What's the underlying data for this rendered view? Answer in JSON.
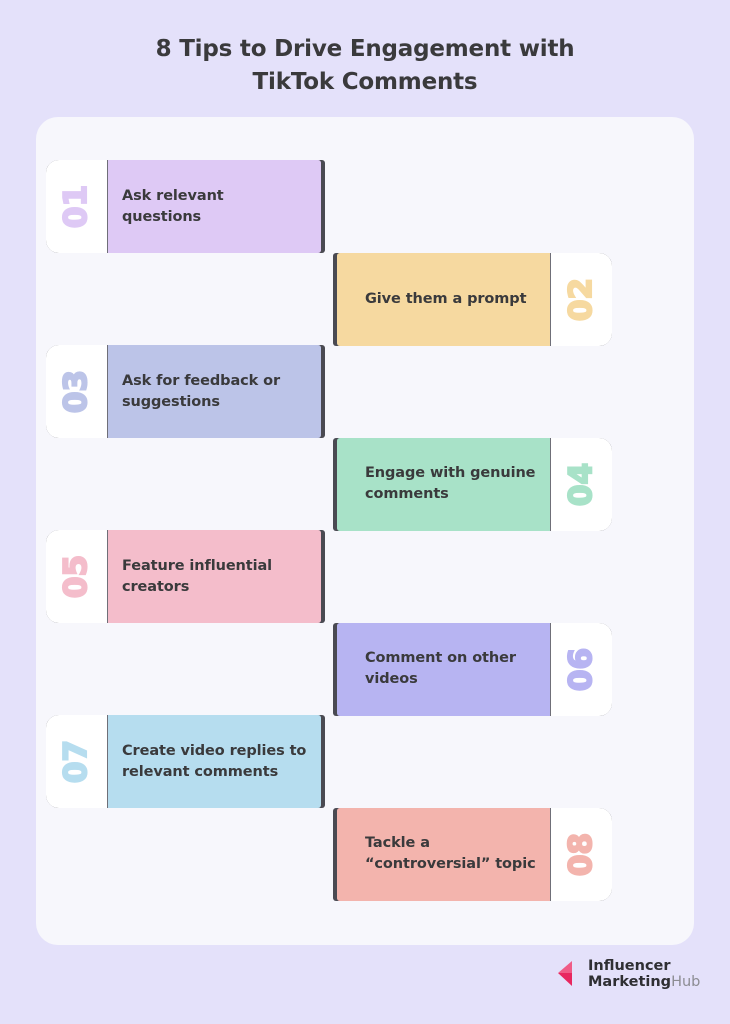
{
  "title": "8 Tips to Drive Engagement with TikTok Comments",
  "title_line1": "8 Tips to Drive Engagement with",
  "title_line2": "TikTok Comments",
  "colors": {
    "page_background": "#e4e1fa",
    "panel_background": "#f7f7fc",
    "text": "#3a3a3c",
    "card_border": "#6f6f78",
    "card_shadow": "#4a4a52"
  },
  "cards": [
    {
      "number": "01",
      "text": "Ask relevant questions",
      "color": "#dec9f5",
      "side": "left"
    },
    {
      "number": "02",
      "text": "Give them a prompt",
      "color": "#f6d9a0",
      "side": "right"
    },
    {
      "number": "03",
      "text": "Ask for feedback or suggestions",
      "color": "#bcc4e8",
      "side": "left"
    },
    {
      "number": "04",
      "text": "Engage with genuine comments",
      "color": "#a8e2c8",
      "side": "right"
    },
    {
      "number": "05",
      "text": "Feature influential creators",
      "color": "#f4bdcb",
      "side": "left"
    },
    {
      "number": "06",
      "text": "Comment on other videos",
      "color": "#b7b4f2",
      "side": "right"
    },
    {
      "number": "07",
      "text": "Create video replies to relevant comments",
      "color": "#b6ddef",
      "side": "left"
    },
    {
      "number": "08",
      "text": "Tackle a “controversial” topic",
      "color": "#f3b4ad",
      "side": "right"
    }
  ],
  "logo": {
    "line1": "Influencer",
    "line2_bold": "Marketing",
    "line2_light": "Hub",
    "mark_color_dark": "#e8275f",
    "mark_color_light": "#f05b86"
  }
}
